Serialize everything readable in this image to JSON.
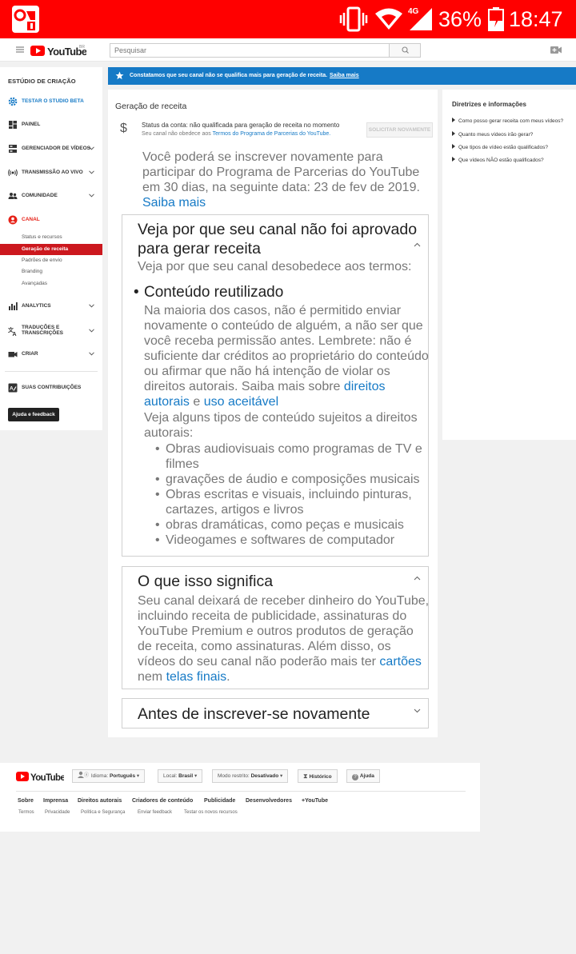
{
  "status_bar": {
    "network": "4G",
    "battery": "36%",
    "time": "18:47"
  },
  "masthead": {
    "logo": "YouTube",
    "region": "BR",
    "search_placeholder": "Pesquisar"
  },
  "sidebar": {
    "heading": "ESTÚDIO DE CRIAÇÃO",
    "studio_beta": "TESTAR O STUDIO BETA",
    "items": {
      "painel": "PAINEL",
      "gerenciador": "GERENCIADOR DE VÍDEOS",
      "transmissao": "TRANSMISSÃO AO VIVO",
      "comunidade": "COMUNIDADE",
      "canal": "CANAL",
      "analytics": "ANALYTICS",
      "traducoes_1": "TRADUÇÕES E",
      "traducoes_2": "TRANSCRIÇÕES",
      "criar": "CRIAR",
      "contribuicoes": "SUAS CONTRIBUIÇÕES"
    },
    "canal_sub": {
      "status": "Status e recursos",
      "geracao": "Geração de receita",
      "padroes": "Padrões de envio",
      "branding": "Branding",
      "avancadas": "Avançadas"
    },
    "feedback_button": "Ajuda e feedback"
  },
  "banner": {
    "text": "Constatamos que seu canal não se qualifica mais para geração de receita.",
    "link": "Saiba mais"
  },
  "main": {
    "title": "Geração de receita",
    "status_label": "Status da conta: não qualificada para geração de receita no momento",
    "status_sub_prefix": "Seu canal não obedece aos",
    "status_sub_link": "Termos do Programa de Parcerias do YouTube.",
    "reapply_button": "SOLICITAR NOVAMENTE",
    "reapply_text": "Você poderá se inscrever novamente para participar do Programa de Parcerias do YouTube em 30 dias, na seguinte data: 23 de fev de 2019.",
    "reapply_link": "Saiba mais",
    "card1": {
      "title_1": "Veja por que seu canal não foi aprovado",
      "title_2": "para gerar receita",
      "intro": "Veja por que seu canal desobedece aos termos:",
      "bullet": "Conteúdo reutilizado",
      "para1": "Na maioria dos casos, não é permitido enviar novamente o conteúdo de alguém, a não ser que você receba permissão antes. Lembrete: não é suficiente dar créditos ao proprietário do conteúdo ou afirmar que não há intenção de violar os direitos autorais. Saiba mais sobre",
      "link_direitos": "direitos autorais",
      "and": "e",
      "link_uso": "uso aceitável",
      "para2": "Veja alguns tipos de conteúdo sujeitos a direitos autorais:",
      "list": [
        "Obras audiovisuais como programas de TV e filmes",
        "gravações de áudio e composições musicais",
        "Obras escritas e visuais, incluindo pinturas, cartazes, artigos e livros",
        "obras dramáticas, como peças e musicais",
        "Videogames e softwares de computador"
      ]
    },
    "card2": {
      "title": "O que isso significa",
      "para": "Seu canal deixará de receber dinheiro do YouTube, incluindo receita de publicidade, assinaturas do YouTube Premium e outros produtos de geração de receita, como assinaturas. Além disso, os vídeos do seu canal não poderão mais ter",
      "link_cartoes": "cartões",
      "nem": "nem",
      "link_telas": "telas finais",
      "end": "."
    },
    "card3": {
      "title": "Antes de inscrever-se novamente"
    }
  },
  "right_panel": {
    "title": "Diretrizes e informações",
    "items": [
      "Como posso gerar receita com meus vídeos?",
      "Quanto meus vídeos irão gerar?",
      "Que tipos de vídeo estão qualificados?",
      "Que vídeos NÃO estão qualificados?"
    ]
  },
  "footer": {
    "logo": "YouTube",
    "language_label": "Idioma:",
    "language_value": "Português",
    "location_label": "Local:",
    "location_value": "Brasil",
    "restricted_label": "Modo restrito:",
    "restricted_value": "Desativado",
    "history": "Histórico",
    "help": "Ajuda",
    "links1": [
      "Sobre",
      "Imprensa",
      "Direitos autorais",
      "Criadores de conteúdo",
      "Publicidade",
      "Desenvolvedores",
      "+YouTube"
    ],
    "links2": [
      "Termos",
      "Privacidade",
      "Política e Segurança",
      "Enviar feedback",
      "Testar os novos recursos"
    ]
  },
  "colors": {
    "youtube_red": "#ff0000",
    "link_blue": "#167ac6",
    "active_red": "#cc181e"
  }
}
